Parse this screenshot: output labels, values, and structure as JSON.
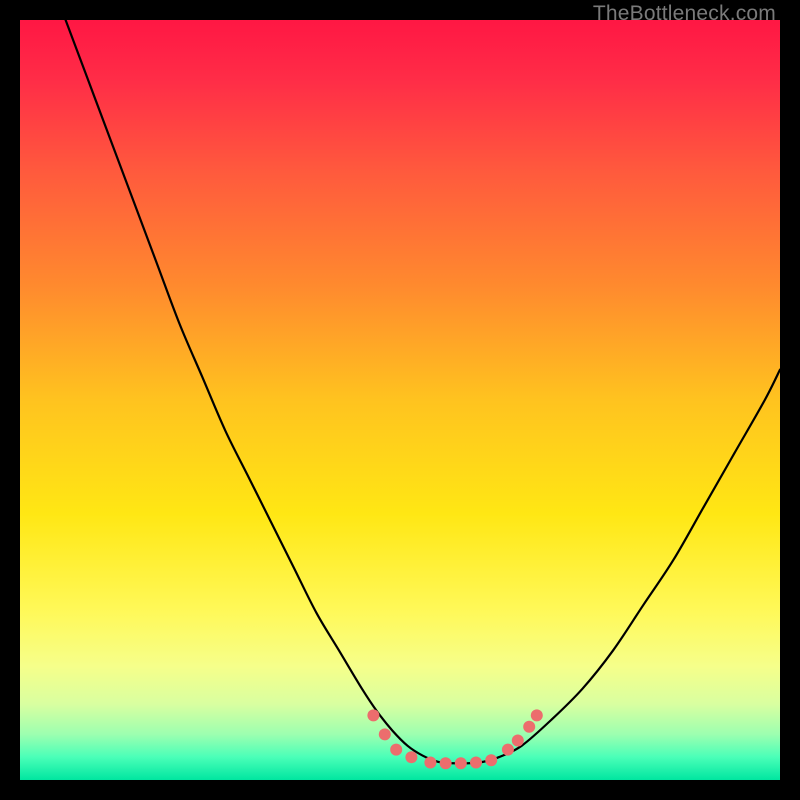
{
  "watermark": "TheBottleneck.com",
  "chart_data": {
    "type": "line",
    "title": "",
    "xlabel": "",
    "ylabel": "",
    "xlim": [
      0,
      100
    ],
    "ylim": [
      0,
      100
    ],
    "background_gradient": {
      "stops": [
        {
          "offset": 0.0,
          "color": "#ff1744"
        },
        {
          "offset": 0.08,
          "color": "#ff2d47"
        },
        {
          "offset": 0.2,
          "color": "#ff5a3d"
        },
        {
          "offset": 0.35,
          "color": "#ff8a2e"
        },
        {
          "offset": 0.5,
          "color": "#ffc31f"
        },
        {
          "offset": 0.65,
          "color": "#ffe714"
        },
        {
          "offset": 0.78,
          "color": "#fff95a"
        },
        {
          "offset": 0.85,
          "color": "#f6ff8a"
        },
        {
          "offset": 0.9,
          "color": "#d9ffa0"
        },
        {
          "offset": 0.94,
          "color": "#9cffb0"
        },
        {
          "offset": 0.97,
          "color": "#4affb8"
        },
        {
          "offset": 1.0,
          "color": "#00e6a0"
        }
      ]
    },
    "series": [
      {
        "name": "bottleneck-curve",
        "color": "#000000",
        "x": [
          6,
          9,
          12,
          15,
          18,
          21,
          24,
          27,
          30,
          33,
          36,
          39,
          42,
          45,
          47,
          49,
          51,
          53,
          55,
          57,
          59,
          61,
          63,
          66,
          70,
          74,
          78,
          82,
          86,
          90,
          94,
          98,
          100
        ],
        "y": [
          100,
          92,
          84,
          76,
          68,
          60,
          53,
          46,
          40,
          34,
          28,
          22,
          17,
          12,
          9,
          6.5,
          4.5,
          3.2,
          2.4,
          2.2,
          2.2,
          2.4,
          3.0,
          4.5,
          8,
          12,
          17,
          23,
          29,
          36,
          43,
          50,
          54
        ]
      }
    ],
    "markers": {
      "name": "highlight-points",
      "color": "#ec6d6d",
      "radius": 6,
      "points": [
        {
          "x": 46.5,
          "y": 8.5
        },
        {
          "x": 48.0,
          "y": 6.0
        },
        {
          "x": 49.5,
          "y": 4.0
        },
        {
          "x": 51.5,
          "y": 3.0
        },
        {
          "x": 54.0,
          "y": 2.3
        },
        {
          "x": 56.0,
          "y": 2.2
        },
        {
          "x": 58.0,
          "y": 2.2
        },
        {
          "x": 60.0,
          "y": 2.3
        },
        {
          "x": 62.0,
          "y": 2.6
        },
        {
          "x": 64.2,
          "y": 4.0
        },
        {
          "x": 65.5,
          "y": 5.2
        },
        {
          "x": 67.0,
          "y": 7.0
        },
        {
          "x": 68.0,
          "y": 8.5
        }
      ]
    }
  }
}
